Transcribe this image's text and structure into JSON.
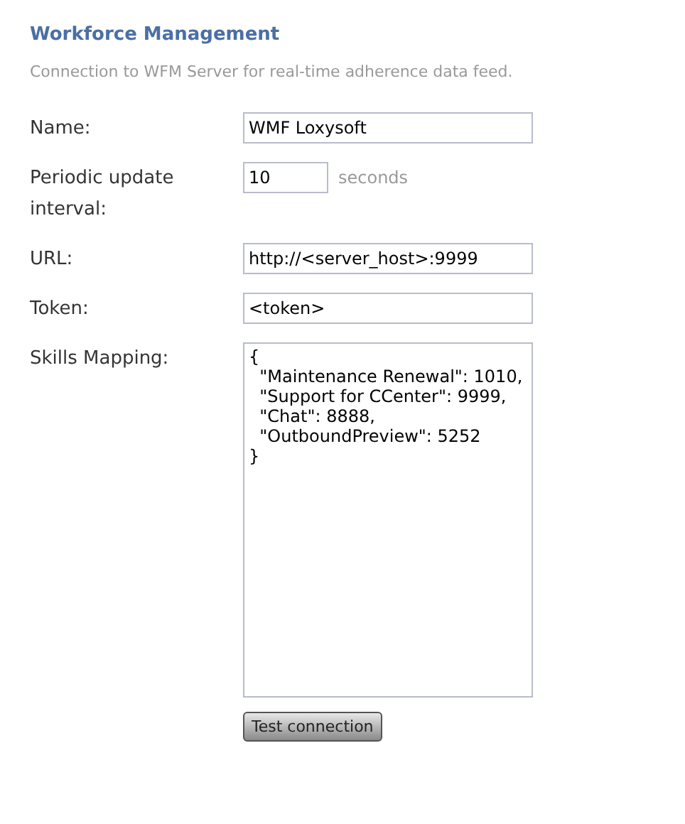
{
  "title": "Workforce Management",
  "description": "Connection to WFM Server for real-time adherence data feed.",
  "fields": [
    {
      "kind": "text",
      "label": "Name:",
      "value": "WMF Loxysoft"
    },
    {
      "kind": "number",
      "label": "Periodic update interval:",
      "value": "10",
      "unit": "seconds"
    },
    {
      "kind": "text",
      "label": "URL:",
      "value": "http://<server_host>:9999"
    },
    {
      "kind": "text",
      "label": "Token:",
      "value": "<token>"
    },
    {
      "kind": "textarea",
      "label": "Skills Mapping:",
      "value": "{\n  \"Maintenance Renewal\": 1010,\n  \"Support for CCenter\": 9999,\n  \"Chat\": 8888,\n  \"OutboundPreview\": 5252\n}"
    }
  ],
  "button": "Test connection"
}
